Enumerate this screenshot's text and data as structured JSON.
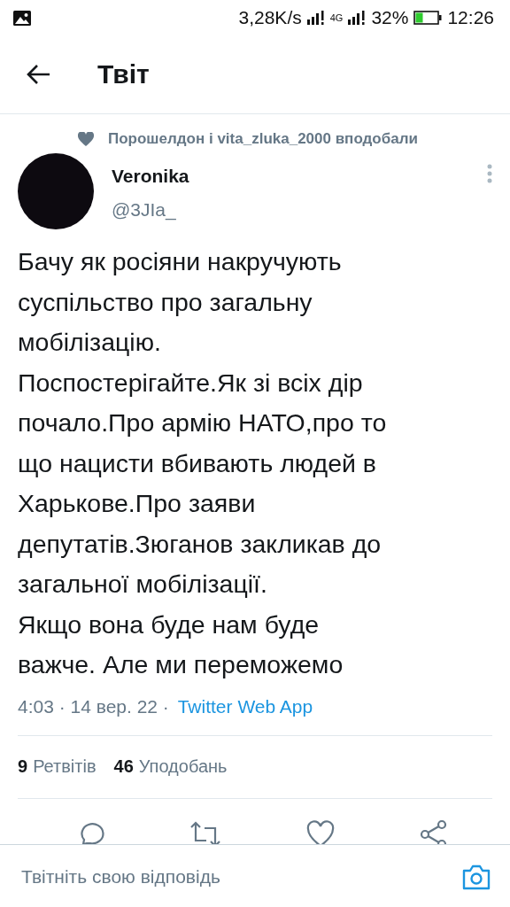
{
  "status_bar": {
    "speed": "3,28K/s",
    "network": "4G",
    "battery": "32%",
    "time": "12:26"
  },
  "header": {
    "title": "Твіт"
  },
  "social_context": {
    "text": "Порошелдон і vita_zluka_2000 вподобали"
  },
  "tweet": {
    "name": "Veronika",
    "handle": "@3JIa_",
    "lines": [
      "Бачу як росіяни накручують",
      "суспільство про загальну",
      "мобілізацію.",
      "Поспостерігайте.Як зі всіх дір",
      "почало.Про армію НАТО,про то",
      "що нацисти вбивають людей в",
      "Харькове.Про заяви",
      "депутатів.Зюганов закликав до",
      "загальної мобілізації.",
      "Якщо вона буде нам буде",
      "важче. Але ми переможемо"
    ],
    "time": "4:03 · 14 вер. 22 · ",
    "source": "Twitter Web App"
  },
  "stats": [
    {
      "count": "9",
      "label": "Ретвітів"
    },
    {
      "count": "46",
      "label": "Уподобань"
    }
  ],
  "actions": [
    {
      "kind": "reply"
    },
    {
      "kind": "retweet"
    },
    {
      "kind": "like"
    },
    {
      "kind": "share"
    }
  ],
  "reply_field": {
    "placeholder": "Твітніть свою відповідь"
  }
}
